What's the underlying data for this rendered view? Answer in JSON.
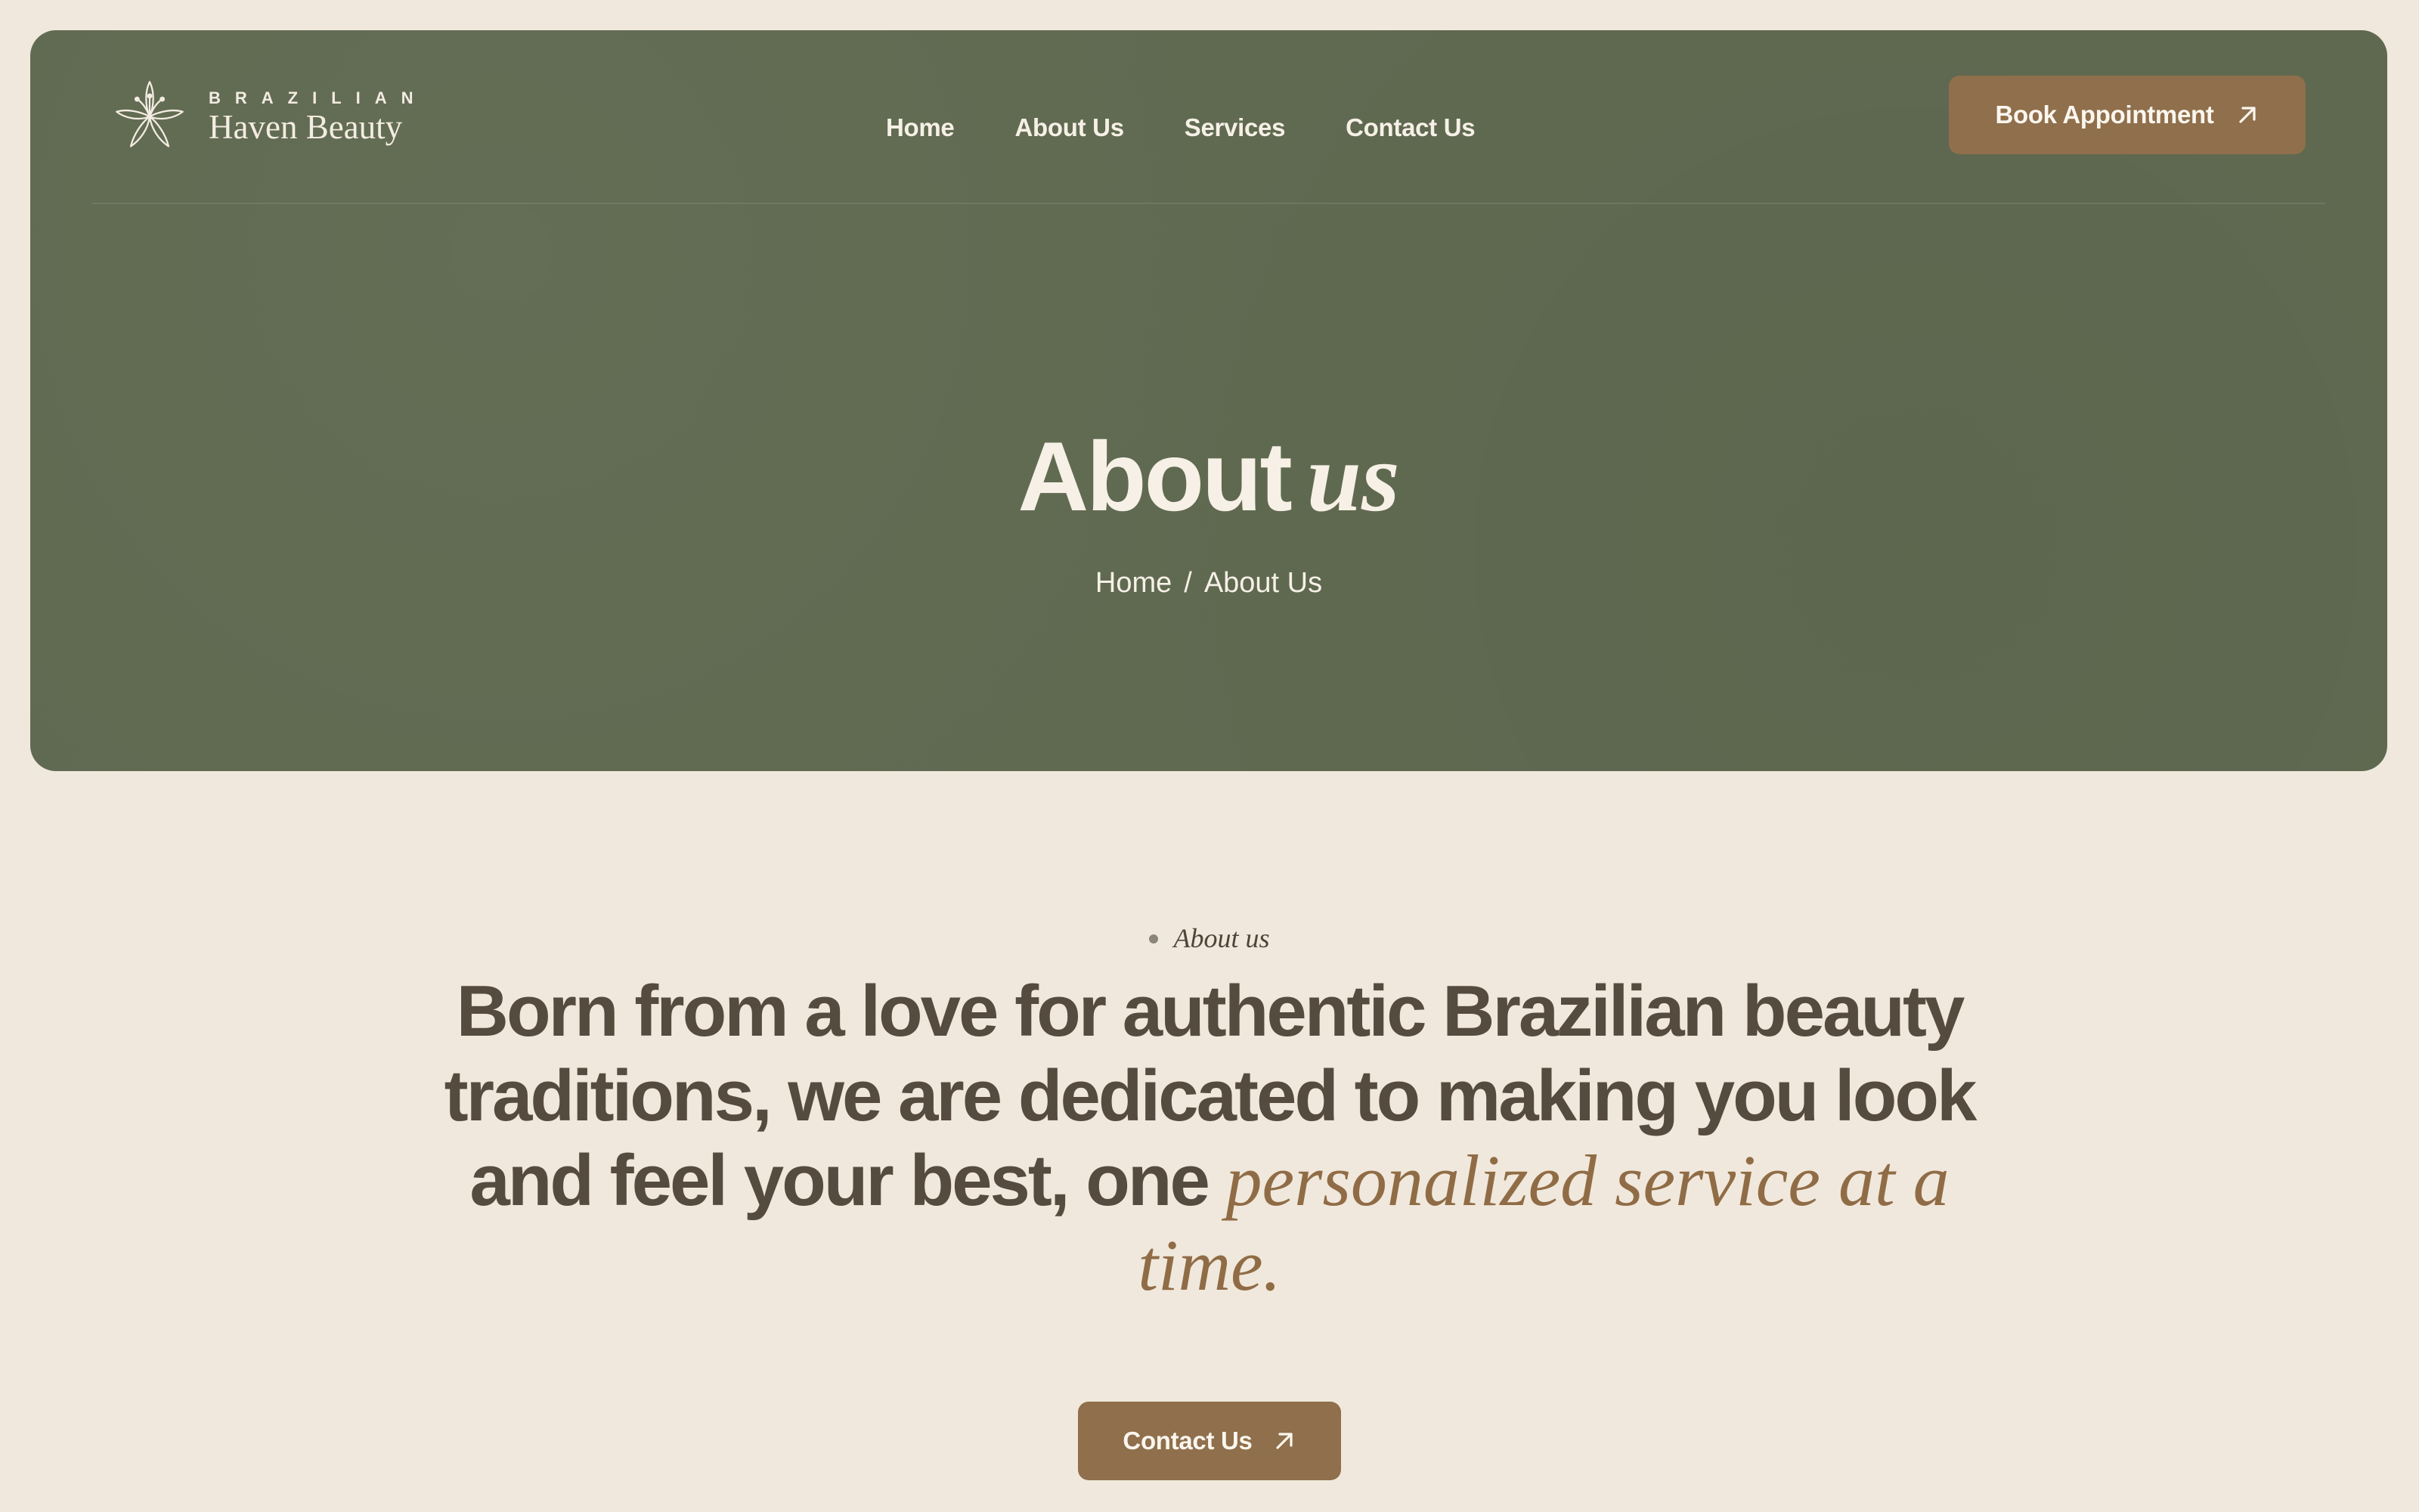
{
  "brand": {
    "sub": "BRAZILIAN",
    "name": "Haven Beauty"
  },
  "nav": {
    "links": [
      "Home",
      "About Us",
      "Services",
      "Contact Us"
    ],
    "cta": "Book Appointment"
  },
  "hero": {
    "title_main": "About",
    "title_italic": "us",
    "breadcrumb": [
      "Home",
      "/",
      "About Us"
    ]
  },
  "about": {
    "label": "About us",
    "statement_main": "Born from a love for authentic Brazilian beauty traditions, we are dedicated to making you look and feel your best, one",
    "statement_accent": "personalized service at a time.",
    "cta": "Contact Us"
  },
  "colors": {
    "background": "#f0e8dc",
    "hero": "#606a51",
    "button": "#8f6f4c",
    "heading": "#554b3e",
    "accent": "#906c46"
  },
  "icons": [
    "lily-flower-logo-icon",
    "arrow-up-right-icon"
  ]
}
